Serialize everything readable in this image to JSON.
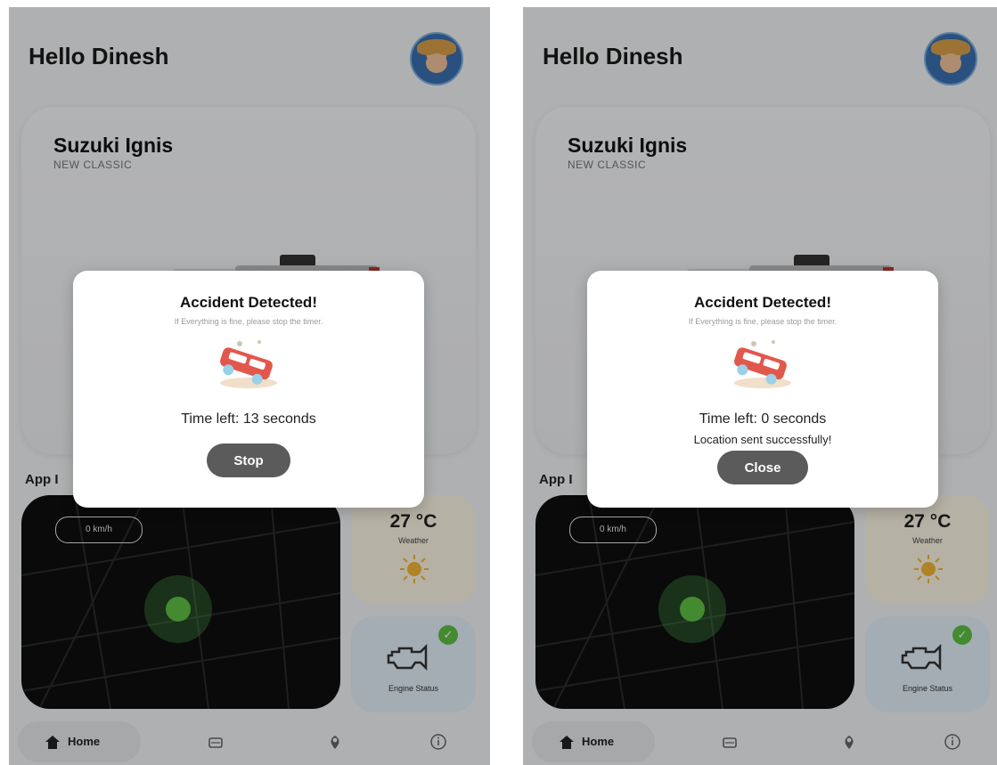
{
  "screens": [
    {
      "greeting": "Hello Dinesh",
      "car": {
        "name": "Suzuki Ignis",
        "variant": "NEW CLASSIC"
      },
      "section_title": "App I",
      "map": {
        "speed": "0 km/h"
      },
      "weather": {
        "temp": "27 °C",
        "label": "Weather"
      },
      "engine": {
        "label": "Engine Status"
      },
      "nav": {
        "home_label": "Home"
      },
      "dialog": {
        "title": "Accident Detected!",
        "subtitle": "If Everything is fine, please stop the timer.",
        "time_text": "Time left: 13 seconds",
        "button_label": "Stop"
      }
    },
    {
      "greeting": "Hello Dinesh",
      "car": {
        "name": "Suzuki Ignis",
        "variant": "NEW CLASSIC"
      },
      "section_title": "App I",
      "map": {
        "speed": "0 km/h"
      },
      "weather": {
        "temp": "27 °C",
        "label": "Weather"
      },
      "engine": {
        "label": "Engine Status"
      },
      "nav": {
        "home_label": "Home"
      },
      "dialog": {
        "title": "Accident Detected!",
        "subtitle": "If Everything is fine, please stop the timer.",
        "time_text": "Time left: 0 seconds",
        "success_text": "Location sent successfully!",
        "button_label": "Close"
      }
    }
  ],
  "icons": [
    "avatar",
    "car-image",
    "location-dot-icon",
    "sun-icon",
    "engine-icon",
    "check-icon",
    "home-icon",
    "car-icon",
    "location-pin-icon",
    "info-icon",
    "accident-car-illustration"
  ],
  "colors": {
    "accent_green": "#5fbf45",
    "button_gray": "#5b5b5b",
    "map_bg": "#0e0f0f",
    "weather_bg": "#fbf6e4",
    "engine_bg": "#e3f0fa"
  }
}
